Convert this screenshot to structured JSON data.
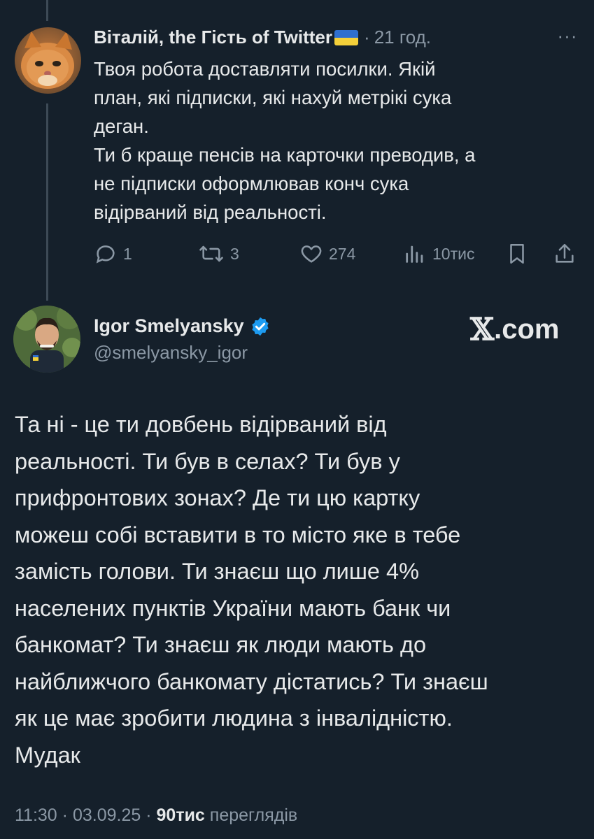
{
  "reply": {
    "author_name": "Віталій, the Гість of Twitter",
    "dot": "·",
    "time": "21 год.",
    "more": "···",
    "text_lines": [
      "Твоя робота доставляти посилки. Якій",
      "план, які підписки, які нахуй метрікі сука",
      "деган.",
      "Ти б краще пенсів на карточки преводив, а",
      "не підписки оформлював конч сука",
      "відірваний від реальності."
    ],
    "actions": {
      "replies": "1",
      "reposts": "3",
      "likes": "274",
      "views": "10тис"
    }
  },
  "main": {
    "author_name": "Igor Smelyansky",
    "handle": "@smelyansky_igor",
    "watermark_glyph": "𝕏",
    "watermark_text": ".com",
    "text_lines": [
      "Та ні - це ти довбень відірваний від",
      "реальності. Ти був в селах? Ти був у",
      "прифронтових зонах? Де ти цю картку",
      "можеш собі вставити в то місто яке в тебе",
      "замість голови. Ти знаєш що лише 4%",
      "населених пунктів України мають банк чи",
      "банкомат? Ти знаєш як люди мають до",
      "найближчого банкомату дістатись? Ти знаєш",
      "як це має зробити людина з інвалідністю.",
      "Мудак"
    ],
    "time": "11:30",
    "date": "03.09.25",
    "views_count": "90тис",
    "views_label": "переглядів"
  },
  "colors": {
    "background": "#15202b",
    "text": "#e7e9ea",
    "muted": "#8b98a5",
    "verified": "#1d9bf0",
    "thread_line": "#3d4a56"
  }
}
